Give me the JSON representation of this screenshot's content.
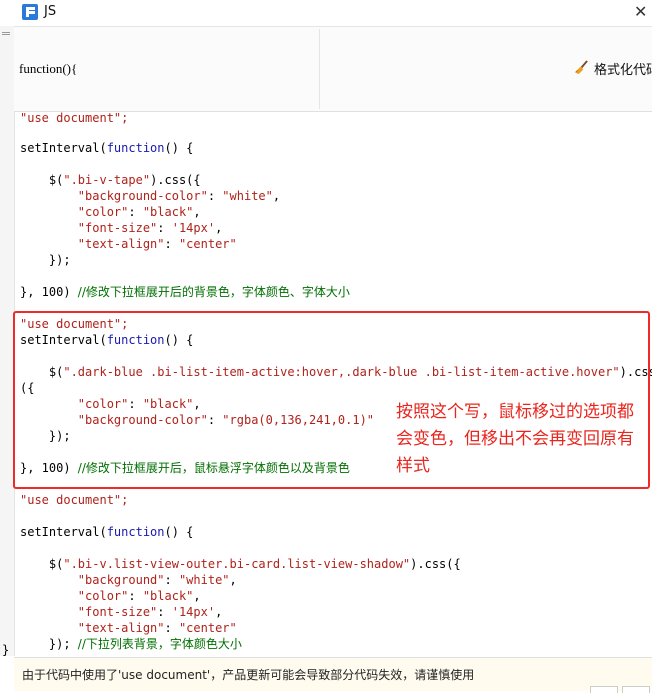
{
  "window": {
    "title": "JS",
    "close_glyph": "✕",
    "app_icon": "fine-report-icon"
  },
  "header": {
    "function_label": "function(){",
    "format_button": "格式化代码"
  },
  "code": {
    "block1": {
      "l1": "\"use document\";",
      "l2_kw": "setInterval(",
      "l2_fn": "function",
      "l2_rest": "() {",
      "l3_a": "    $(",
      "l3_sel": "\".bi-v-tape\"",
      "l3_b": ").css({",
      "l4_k": "        \"background-color\"",
      "l4_v": "\"white\"",
      "l5_k": "        \"color\"",
      "l5_v": "\"black\"",
      "l6_k": "        \"font-size\"",
      "l6_v": "'14px'",
      "l7_k": "        \"text-align\"",
      "l7_v": "\"center\"",
      "l8": "    });",
      "l9": "}, 100) ",
      "l9_cmt": "//修改下拉框展开后的背景色，字体颜色、字体大小"
    },
    "block2": {
      "l1": "\"use document\";",
      "l2_kw": "setInterval(",
      "l2_fn": "function",
      "l2_rest": "() {",
      "l3_a": "    $(",
      "l3_sel": "\".dark-blue .bi-list-item-active:hover,.dark-blue .bi-list-item-active.hover\"",
      "l3_b": ").css",
      "l4": "({",
      "l5_k": "        \"color\"",
      "l5_v": "\"black\"",
      "l6_k": "        \"background-color\"",
      "l6_v": "\"rgba(0,136,241,0.1)\"",
      "l7": "    });",
      "l8": "}, 100) ",
      "l8_cmt": "//修改下拉框展开后，鼠标悬浮字体颜色以及背景色"
    },
    "block3": {
      "l1": "\"use document\";",
      "l2_kw": "setInterval(",
      "l2_fn": "function",
      "l2_rest": "() {",
      "l3_a": "    $(",
      "l3_sel": "\".bi-v.list-view-outer.bi-card.list-view-shadow\"",
      "l3_b": ").css({",
      "l4_k": "        \"background\"",
      "l4_v": "\"white\"",
      "l5_k": "        \"color\"",
      "l5_v": "\"black\"",
      "l6_k": "        \"font-size\"",
      "l6_v": "'14px'",
      "l7_k": "        \"text-align\"",
      "l7_v": "\"center\"",
      "l8": "    }); ",
      "l8_cmt": "//下拉列表背景，字体颜色大小"
    },
    "closing_brace": "}"
  },
  "annotation": {
    "text": "按照这个写，鼠标移过的选项都会变色，但移出不会再变回原有样式",
    "color": "#e8261e"
  },
  "status": {
    "warning": "由于代码中使用了'use document'，产品更新可能会导致部分代码失效，请谨慎使用"
  },
  "colors": {
    "string": "#b0221b",
    "keyword": "#1a1ab0",
    "comment": "#006f00",
    "highlight_border": "#ee2a2a"
  }
}
